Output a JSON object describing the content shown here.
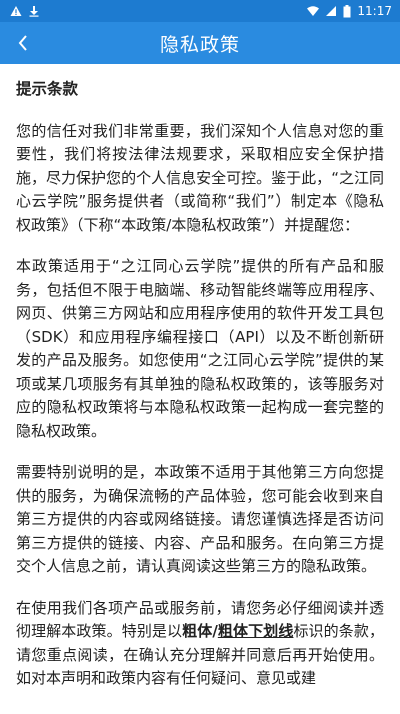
{
  "status_bar": {
    "time": "11:17"
  },
  "app_bar": {
    "title": "隐私政策"
  },
  "content": {
    "heading": "提示条款",
    "paragraphs": [
      "您的信任对我们非常重要，我们深知个人信息对您的重要性，我们将按法律法规要求，采取相应安全保护措施，尽力保护您的个人信息安全可控。鉴于此，“之江同心云学院”服务提供者（或简称“我们”）制定本《隐私权政策》（下称“本政策/本隐私权政策”）并提醒您：",
      "本政策适用于“之江同心云学院”提供的所有产品和服务，包括但不限于电脑端、移动智能终端等应用程序、网页、供第三方网站和应用程序使用的软件开发工具包（SDK）和应用程序编程接口（API）以及不断创新研发的产品及服务。如您使用“之江同心云学院”提供的某项或某几项服务有其单独的隐私权政策的，该等服务对应的隐私权政策将与本隐私权政策一起构成一套完整的隐私权政策。",
      "需要特别说明的是，本政策不适用于其他第三方向您提供的服务，为确保流畅的产品体验，您可能会收到来自第三方提供的内容或网络链接。请您谨慎选择是否访问第三方提供的链接、内容、产品和服务。在向第三方提交个人信息之前，请认真阅读这些第三方的隐私政策。"
    ],
    "p4_before": "在使用我们各项产品或服务前，请您务必仔细阅读并透彻理解本政策。特别是以",
    "p4_bold": "粗体/",
    "p4_bold_underline": "粗体下划线",
    "p4_after": "标识的条款，请您重点阅读，在确认充分理解并同意后再开始使用。如对本声明和政策内容有任何疑问、意见或建"
  }
}
